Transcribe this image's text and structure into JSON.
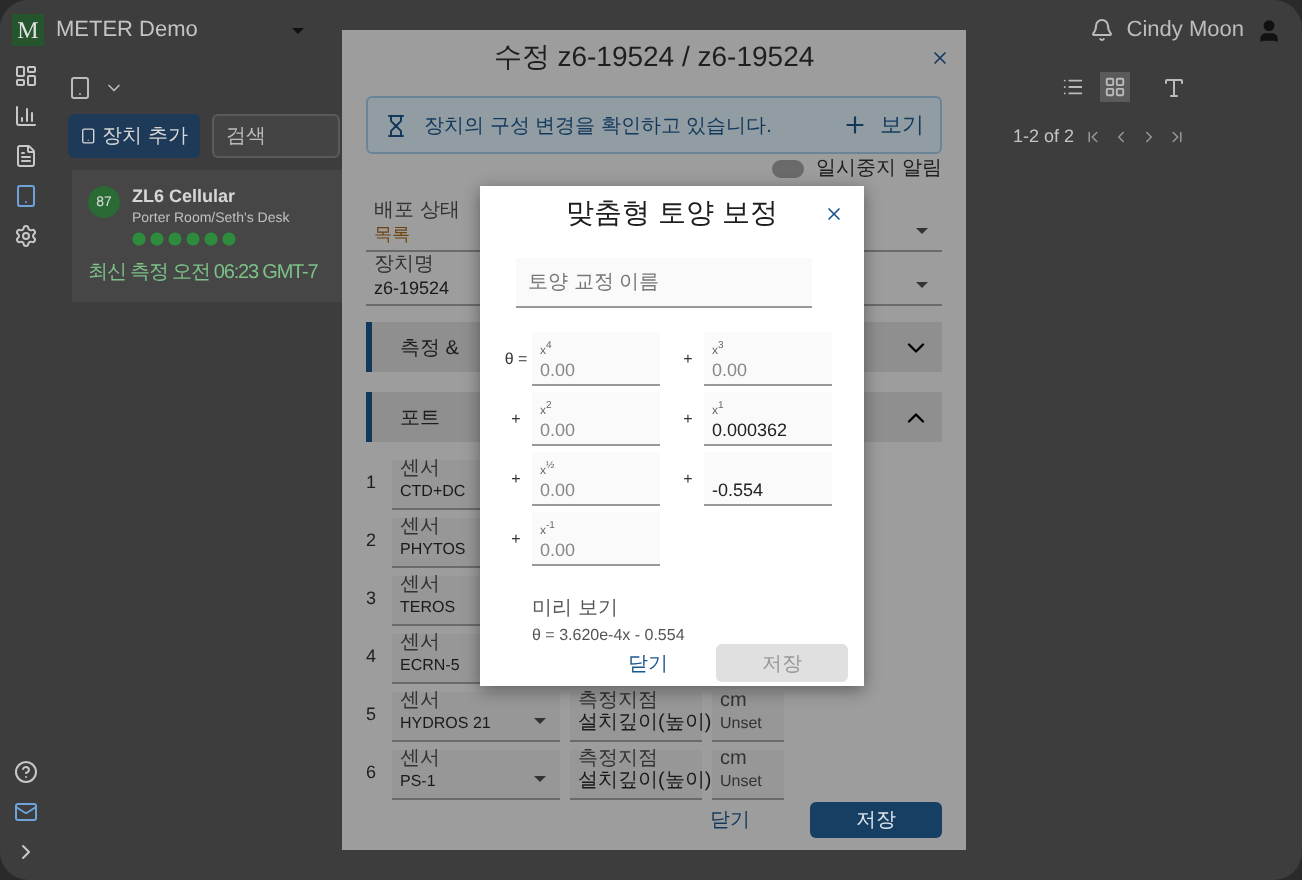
{
  "app": {
    "logo": "M",
    "org": "METER Demo",
    "user": "Cindy Moon",
    "nav": [
      {
        "selected": false
      },
      {
        "selected": false
      },
      {
        "selected": false
      },
      {
        "selected": true
      },
      {
        "selected": false
      }
    ],
    "add_button": "장치 추가",
    "search": {
      "placeholder": "검색"
    },
    "views": [
      {
        "selected": false
      },
      {
        "selected": true
      }
    ],
    "pagination": "1-2 of 2",
    "devices": [
      {
        "badge": "87",
        "name": "ZL6 Cellular",
        "location": "Porter Room/Seth's Desk",
        "latest": "최신 측정 오전 06:23 GMT-7"
      }
    ]
  },
  "edit_dialog": {
    "title": "수정 z6-19524 / z6-19524",
    "banner": {
      "text": "장치의 구성 변경을 확인하고 있습니다.",
      "action": "보기"
    },
    "pause_alerts": {
      "label": "일시중지 알림",
      "on": false
    },
    "fields": [
      {
        "kind": "status",
        "label": "배포 상태",
        "value": "목록"
      },
      {
        "kind": "text",
        "label": "장치명",
        "value": "z6-19524"
      }
    ],
    "sections": [
      {
        "title": "측정 &",
        "expanded": false
      },
      {
        "title": "포트",
        "expanded": true
      }
    ],
    "ports": [
      {
        "number": "1",
        "sensor_label": "센서",
        "sensor": "CTD+DC"
      },
      {
        "number": "2",
        "sensor_label": "센서",
        "sensor": "PHYTOS"
      },
      {
        "number": "3",
        "sensor_label": "센서",
        "sensor": "TEROS"
      },
      {
        "number": "4",
        "sensor_label": "센서",
        "sensor": "ECRN-5"
      },
      {
        "number": "5",
        "sensor_label": "센서",
        "sensor": "HYDROS 21",
        "location_label": "측정지점",
        "location": "설치깊이(높이)",
        "unit_label": "cm",
        "depth": "Unset"
      },
      {
        "number": "6",
        "sensor_label": "센서",
        "sensor": "PS-1",
        "location_label": "측정지점",
        "location": "설치깊이(높이)",
        "unit_label": "cm",
        "depth": "Unset"
      }
    ],
    "cancel": "닫기",
    "save": "저장"
  },
  "calibration_dialog": {
    "title": "맞춤형 토양 보정",
    "name_field": {
      "placeholder": "토양 교정 이름"
    },
    "terms": [
      {
        "sign": "θ =",
        "label": "x$^{4}$",
        "placeholder": "0.00"
      },
      {
        "sign": "+",
        "label": "x$^{3}$",
        "placeholder": "0.00"
      },
      {
        "sign": "+",
        "label": "x$^{2}$",
        "placeholder": "0.00"
      },
      {
        "sign": "+",
        "label": "x$^{1}$",
        "value": "0.000362"
      },
      {
        "sign": "+",
        "label": "x$^{½}$",
        "placeholder": "0.00"
      },
      {
        "sign": "+",
        "value": "-0.554"
      },
      {
        "sign": "+",
        "label": "x$^{-1}$",
        "placeholder": "0.00"
      }
    ],
    "preview": {
      "label": "미리 보기",
      "formula": "θ = 3.620e-4x - 0.554"
    },
    "cancel": "닫기",
    "save": "저장",
    "save_disabled": true
  }
}
